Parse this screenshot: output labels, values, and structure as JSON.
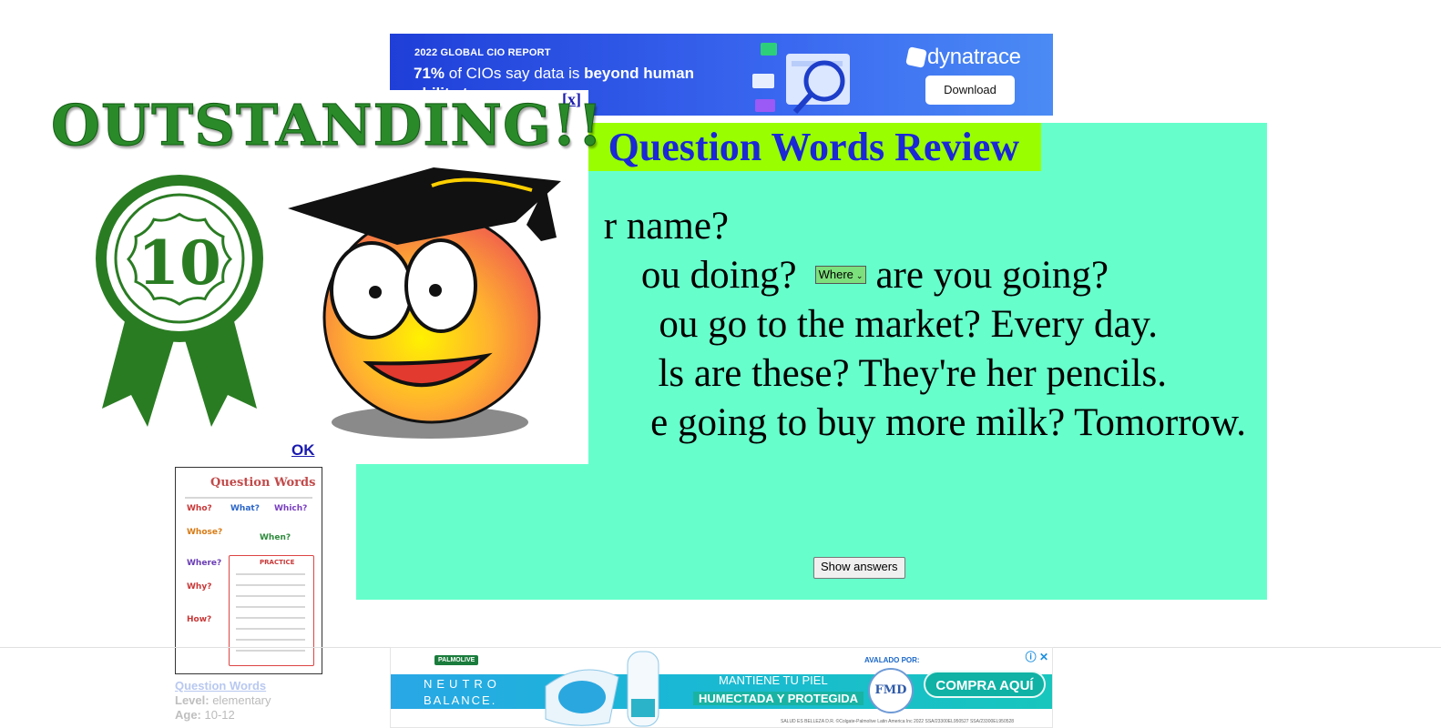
{
  "top_ad": {
    "kicker": "2022 GLOBAL CIO REPORT",
    "headline_stat": "71%",
    "headline_mid": " of CIOs say data is ",
    "headline_bold": "beyond human",
    "headline_line2": "ability to manage",
    "brand": "dynatrace",
    "cta": "Download",
    "colors": {
      "bg": "#2b52e4",
      "accent": "#ffffff"
    }
  },
  "popup": {
    "close_label": "x",
    "banner": "OUTSTANDING!!",
    "score": "10",
    "ok_label": "OK",
    "icons": [
      "ribbon-award-icon",
      "graduate-smiley-icon"
    ]
  },
  "exercise": {
    "title": "Question Words Review",
    "questions": [
      "r name?",
      "ou doing?",
      "ou go to the market?  Every day.",
      "ls are these?  They're her pencils.",
      "e going to buy more milk?  Tomorrow."
    ],
    "q2_suffix": "are you going?",
    "select_value": "Where",
    "show_answers_label": "Show answers",
    "colors": {
      "panel": "#66ffcc",
      "title_bg": "#99ff00",
      "title_text": "#1a28d6"
    }
  },
  "worksheet_card": {
    "thumb_title": "Question Words",
    "wh_words": [
      "Who?",
      "What?",
      "Which?",
      "Whose?",
      "When?",
      "Where?",
      "Why?",
      "How?",
      "PRACTICE"
    ],
    "link": "Question Words",
    "level_label": "Level:",
    "level_value": "elementary",
    "age_label": "Age:",
    "age_value": "10-12"
  },
  "bottom_ad": {
    "brand": "PALMOLIVE",
    "line1": "NEUTRO",
    "line2": "BALANCE.",
    "tag1": "MANTIENE TU PIEL",
    "tag2": "HUMECTADA Y PROTEGIDA",
    "endorsed": "AVALADO POR:",
    "seal": "FMD",
    "cta": "COMPRA AQUÍ",
    "legal": "SALUD ES BELLEZA D.R. ©Colgate-Palmolive Latin America Inc 2022  SSA/23300EL950527  SSA/23300EL950528"
  }
}
